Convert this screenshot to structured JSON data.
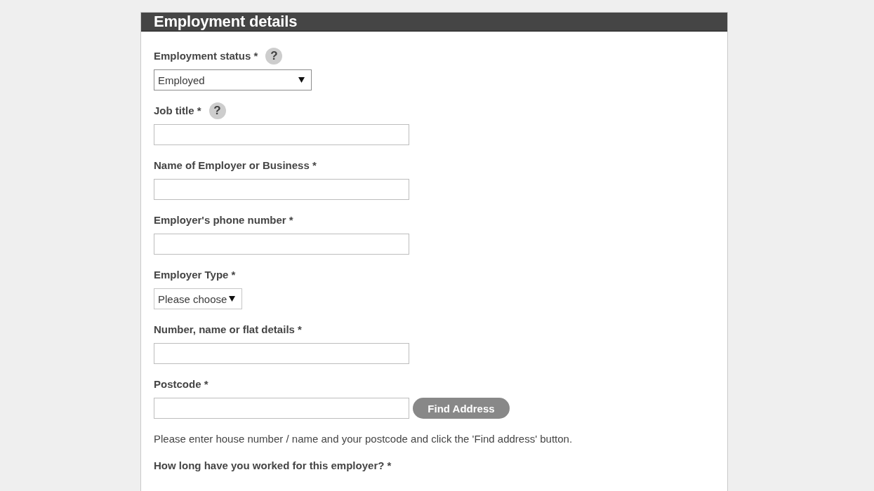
{
  "section": {
    "title": "Employment details"
  },
  "items": [
    {
      "kind": "select",
      "label": "Employment status *",
      "help": "?",
      "value": "Employed",
      "compact": false
    },
    {
      "kind": "text",
      "label": "Job title *",
      "help": "?"
    },
    {
      "kind": "text",
      "label": "Name of Employer or Business *"
    },
    {
      "kind": "text",
      "label": "Employer's phone number *"
    },
    {
      "kind": "select",
      "label": "Employer Type *",
      "value": "Please choose",
      "compact": true
    },
    {
      "kind": "text",
      "label": "Number, name or flat details *"
    },
    {
      "kind": "lookup",
      "label": "Postcode *",
      "button": "Find Address"
    },
    {
      "kind": "note",
      "text": "Please enter house number / name and your postcode and click the 'Find address' button."
    },
    {
      "kind": "label",
      "label": "How long have you worked for this employer? *"
    }
  ]
}
